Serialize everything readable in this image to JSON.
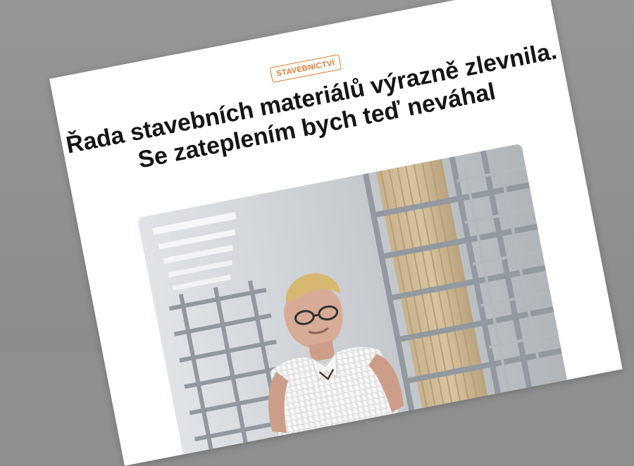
{
  "article": {
    "category": "STAVEBNICTVÍ",
    "headline": "Řada stavebních materiálů výrazně zlevnila. Se zateplením bych teď neváhal"
  },
  "photo": {
    "subject": "man in white knit polo shirt and glasses standing in warehouse aisle with metal racks and stacked insulation boards"
  }
}
